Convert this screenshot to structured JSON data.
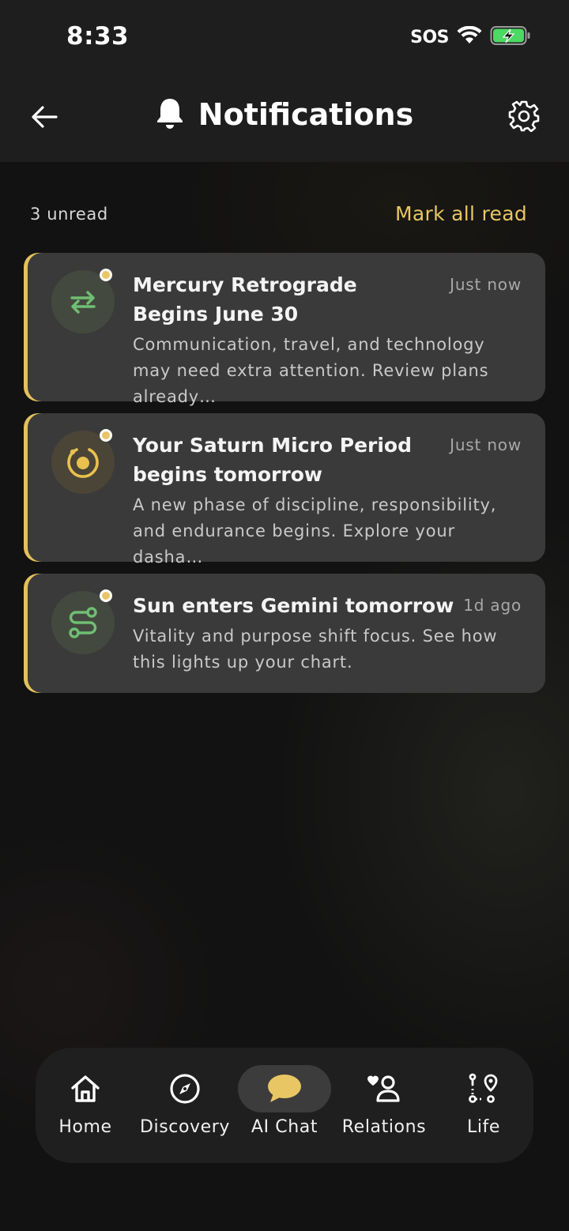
{
  "status": {
    "time": "8:33",
    "carrier": "SOS"
  },
  "header": {
    "title": "Notifications"
  },
  "summary": {
    "unread": "3 unread",
    "mark_all": "Mark all read"
  },
  "notifications": [
    {
      "title": "Mercury Retrograde Begins June 30",
      "time": "Just now",
      "body": "Communication, travel, and technology may need extra attention. Review plans already…",
      "icon": "swap-arrows-icon",
      "unread": true
    },
    {
      "title": "Your Saturn Micro Period begins tomorrow",
      "time": "Just now",
      "body": "A new phase of discipline, responsibility, and endurance begins. Explore your dasha…",
      "icon": "orbit-target-icon",
      "unread": true
    },
    {
      "title": "Sun enters Gemini tomorrow",
      "time": "1d ago",
      "body": "Vitality and purpose shift focus. See how this lights up your chart.",
      "icon": "route-icon",
      "unread": true
    }
  ],
  "nav": {
    "items": [
      {
        "label": "Home",
        "icon": "home-icon"
      },
      {
        "label": "Discovery",
        "icon": "compass-icon"
      },
      {
        "label": "AI Chat",
        "icon": "chat-bubble-icon",
        "active": true
      },
      {
        "label": "Relations",
        "icon": "relations-icon"
      },
      {
        "label": "Life",
        "icon": "life-path-icon"
      }
    ]
  },
  "colors": {
    "accent": "#e8c664",
    "card": "#3a3a3a",
    "bar": "#1e1e1e",
    "green": "#6fbf73"
  }
}
